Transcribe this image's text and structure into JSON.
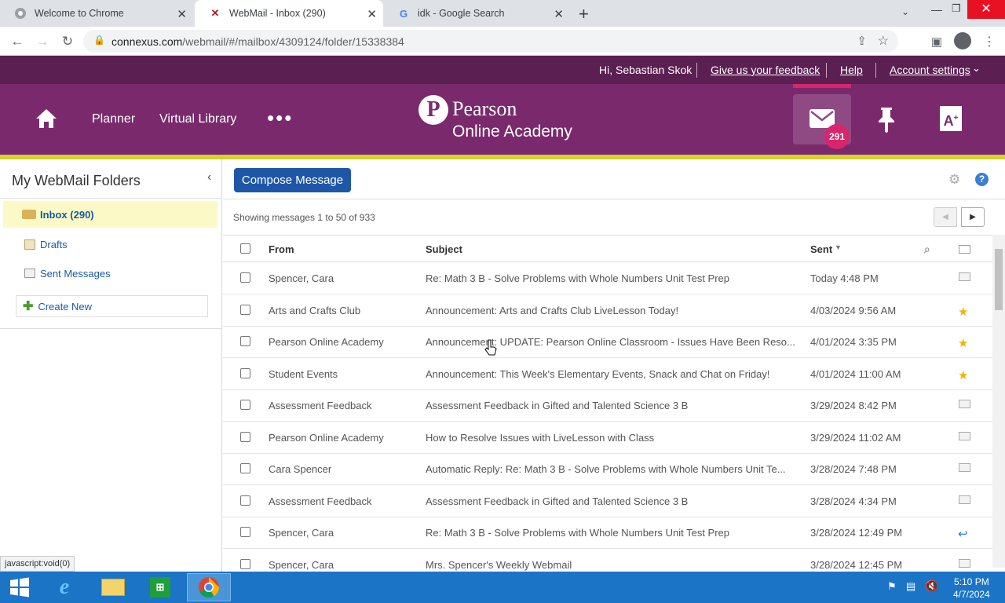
{
  "tabs": [
    {
      "title": "Welcome to Chrome"
    },
    {
      "title": "WebMail - Inbox (290)"
    },
    {
      "title": "idk - Google Search"
    }
  ],
  "url": {
    "host": "connexus.com",
    "path": "/webmail/#/mailbox/4309124/folder/15338384"
  },
  "topbar": {
    "greeting": "Hi, Sebastian Skok",
    "feedback": "Give us your feedback",
    "help": "Help",
    "account": "Account settings"
  },
  "nav": {
    "planner": "Planner",
    "library": "Virtual Library",
    "more": "•••"
  },
  "logo": {
    "line1": "Pearson",
    "line2": "Online Academy"
  },
  "mail_badge": "291",
  "sidebar": {
    "title": "My WebMail Folders",
    "folders": [
      {
        "label": "Inbox (290)"
      },
      {
        "label": "Drafts"
      },
      {
        "label": "Sent Messages"
      }
    ],
    "create_new": "Create New"
  },
  "compose": "Compose Message",
  "showing": "Showing messages 1 to 50 of 933",
  "columns": {
    "from": "From",
    "subject": "Subject",
    "sent": "Sent"
  },
  "messages": [
    {
      "from": "Spencer, Cara",
      "subject": "Re: Math 3 B - Solve Problems with Whole Numbers Unit Test Prep",
      "sent": "Today 4:48 PM",
      "icon": "envelope-icon"
    },
    {
      "from": "Arts and Crafts Club",
      "subject": "Announcement: Arts and Crafts Club LiveLesson Today!",
      "sent": "4/03/2024 9:56 AM",
      "icon": "star-icon"
    },
    {
      "from": "Pearson Online Academy",
      "subject": "Announcement: UPDATE: Pearson Online Classroom - Issues Have Been Reso...",
      "sent": "4/01/2024 3:35 PM",
      "icon": "star-icon"
    },
    {
      "from": "Student Events",
      "subject": "Announcement: This Week's Elementary Events, Snack and Chat on Friday!",
      "sent": "4/01/2024 11:00 AM",
      "icon": "star-icon"
    },
    {
      "from": "Assessment Feedback",
      "subject": "Assessment Feedback in Gifted and Talented Science 3 B",
      "sent": "3/29/2024 8:42 PM",
      "icon": "envelope-icon"
    },
    {
      "from": "Pearson Online Academy",
      "subject": "How to Resolve Issues with LiveLesson with Class",
      "sent": "3/29/2024 11:02 AM",
      "icon": "envelope-icon"
    },
    {
      "from": "Cara Spencer",
      "subject": "Automatic Reply: Re: Math 3 B - Solve Problems with Whole Numbers Unit Te...",
      "sent": "3/28/2024 7:48 PM",
      "icon": "envelope-icon"
    },
    {
      "from": "Assessment Feedback",
      "subject": "Assessment Feedback in Gifted and Talented Science 3 B",
      "sent": "3/28/2024 4:34 PM",
      "icon": "envelope-icon"
    },
    {
      "from": "Spencer, Cara",
      "subject": "Re: Math 3 B - Solve Problems with Whole Numbers Unit Test Prep",
      "sent": "3/28/2024 12:49 PM",
      "icon": "reply-icon"
    },
    {
      "from": "Spencer, Cara",
      "subject": "Mrs. Spencer's Weekly Webmail",
      "sent": "3/28/2024 12:45 PM",
      "icon": "envelope-icon"
    }
  ],
  "status_url": "javascript:void(0)",
  "clock": {
    "time": "5:10 PM",
    "date": "4/7/2024"
  },
  "colors": {
    "header": "#7a2a6c",
    "topbar": "#5b1f52",
    "accent": "#d6d22a",
    "badge": "#d9256b",
    "button": "#1e57a8"
  }
}
